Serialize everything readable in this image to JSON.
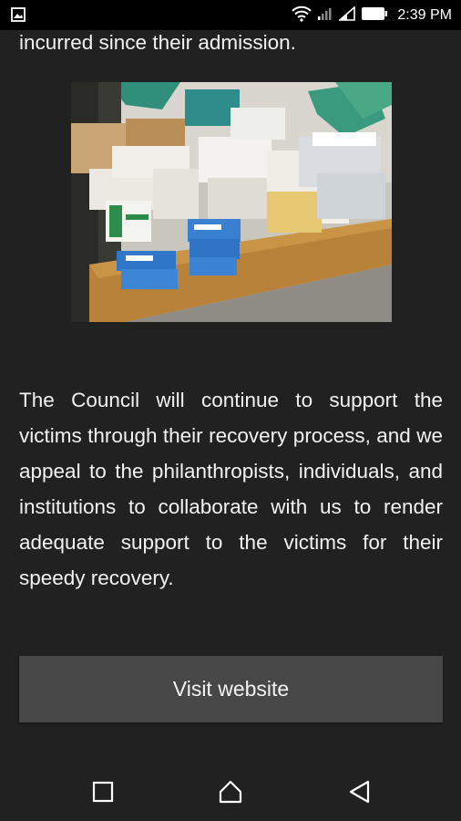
{
  "status_bar": {
    "time": "2:39 PM",
    "icons": [
      "image-icon",
      "wifi-icon",
      "cell-signal-weak-icon",
      "cell-signal-icon",
      "battery-icon"
    ]
  },
  "article": {
    "top_paragraph_tail": "incurred since their admission.",
    "image_alt": "Boxes of medicine stacked on a table",
    "paragraph": "The Council will continue to support the victims through their recovery process, and we appeal to the philanthropists, individuals, and institutions to collaborate with us to render adequate support to the victims for their speedy recovery."
  },
  "actions": {
    "visit_website_label": "Visit website"
  },
  "nav_bar": {
    "icons": [
      "recent-apps-icon",
      "home-icon",
      "back-icon"
    ]
  },
  "colors": {
    "background": "#212121",
    "status_bar": "#000000",
    "button": "#474747",
    "text": "#f2f2f2"
  }
}
